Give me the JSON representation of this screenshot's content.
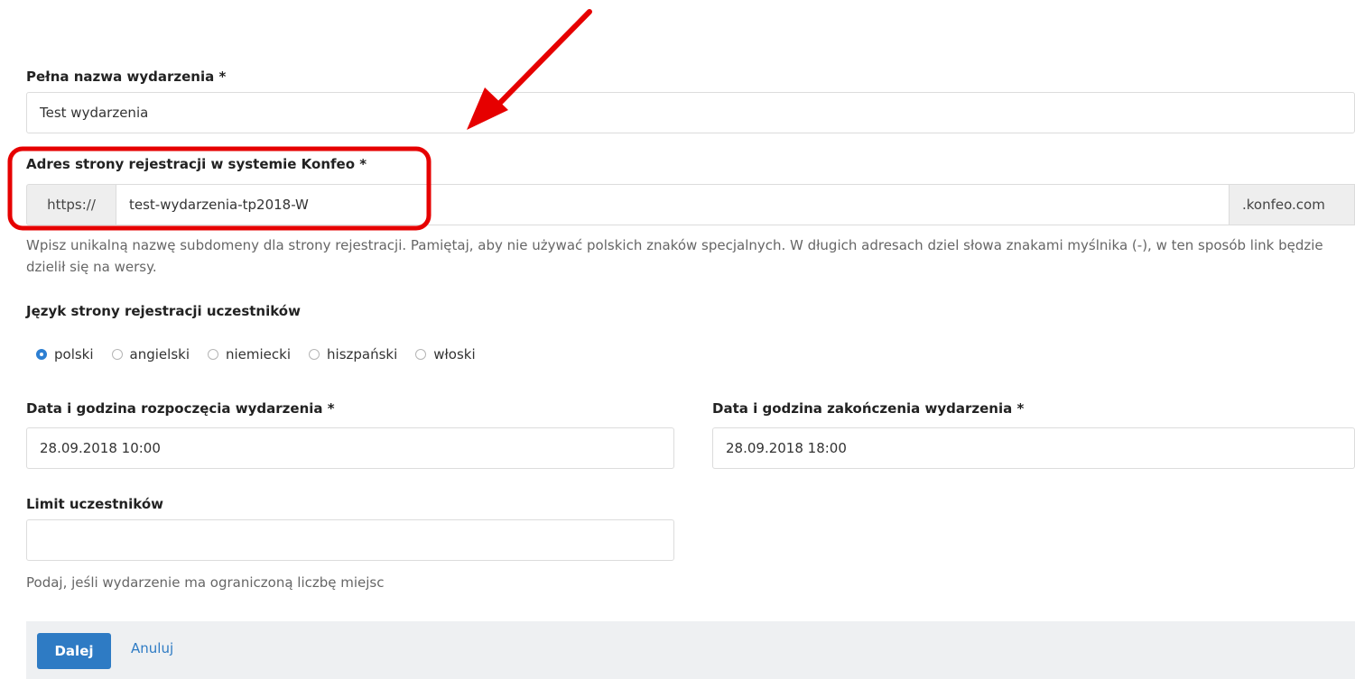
{
  "colors": {
    "accent": "#2e7bc4",
    "annotation": "#e60000"
  },
  "event_name": {
    "label": "Pełna nazwa wydarzenia *",
    "value": "Test wydarzenia"
  },
  "registration_address": {
    "label": "Adres strony rejestracji w systemie Konfeo *",
    "prefix": "https://",
    "value": "test-wydarzenia-tp2018-W",
    "suffix": ".konfeo.com",
    "help": "Wpisz unikalną nazwę subdomeny dla strony rejestracji. Pamiętaj, aby nie używać polskich znaków specjalnych. W długich adresach dziel słowa znakami myślnika (-), w ten sposób link będzie dzielił się na wersy."
  },
  "language": {
    "label": "Język strony rejestracji uczestników",
    "options": [
      {
        "label": "polski",
        "selected": true
      },
      {
        "label": "angielski",
        "selected": false
      },
      {
        "label": "niemiecki",
        "selected": false
      },
      {
        "label": "hiszpański",
        "selected": false
      },
      {
        "label": "włoski",
        "selected": false
      }
    ]
  },
  "start_datetime": {
    "label": "Data i godzina rozpoczęcia wydarzenia *",
    "value": "28.09.2018 10:00"
  },
  "end_datetime": {
    "label": "Data i godzina zakończenia wydarzenia *",
    "value": "28.09.2018 18:00"
  },
  "participant_limit": {
    "label": "Limit uczestników",
    "value": "",
    "help": "Podaj, jeśli wydarzenie ma ograniczoną liczbę miejsc"
  },
  "actions": {
    "next_label": "Dalej",
    "cancel_label": "Anuluj"
  }
}
